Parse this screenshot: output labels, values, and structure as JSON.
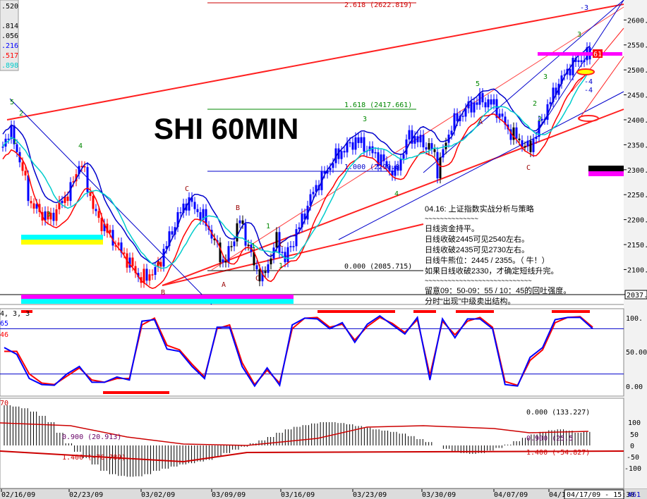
{
  "chart_data": {
    "type": "candlestick",
    "title": "SHI 60MIN",
    "price_axis": {
      "min": 2030,
      "max": 2640,
      "ticks": [
        "2600.",
        "2550.",
        "2500.",
        "2450.",
        "2400.",
        "2350.",
        "2300.",
        "2250.",
        "2200.",
        "2150.",
        "2100.",
        "2050."
      ],
      "current_price_label": "2037.4"
    },
    "left_values": [
      ".520",
      ".814",
      ".056",
      ".216",
      ".517",
      ".898"
    ],
    "left_value_colors": [
      "#000000",
      "#000000",
      "#000000",
      "#0000ff",
      "#ff0000",
      "#00cccc"
    ],
    "x_dates": [
      "02/16/09",
      "02/23/09",
      "03/02/09",
      "03/09/09",
      "03/16/09",
      "03/23/09",
      "03/30/09",
      "04/07/09",
      "04/1"
    ],
    "current_time_label": "04/17/09 - 15:30",
    "corner_label": "#61",
    "fib_labels": [
      "2.618 (2622.819)",
      "1.618 (2417.661)",
      "1.000 (2290.8",
      "0.000 (2085.715)"
    ],
    "wave_labels": {
      "digits": [
        "5",
        "2",
        "1",
        "4",
        "3",
        "2",
        "1",
        "3",
        "4",
        "5",
        "2",
        "1",
        "3",
        "3",
        "1"
      ],
      "letters": [
        "C",
        "B",
        "A",
        "B",
        "A",
        "C",
        "A",
        "C",
        "C"
      ]
    },
    "markers": [
      "-3",
      "-4",
      "-4",
      "61"
    ],
    "notes": {
      "title": "04.16: 上证指数实战分析与策略",
      "separator": "~~~~~~~~~~~~~~",
      "lines": [
        "日线资金持平。",
        "日线收破2445可见2540左右。",
        "日线收破2435可见2730左右。",
        "日线牛熊位：2445 / 2355。（ 牛！）",
        "如果日线收破2330，才确定短线升完。"
      ],
      "separator2": "~~~~~~~~~~~~~~~~~~~~~~~~~~~~",
      "lines2": [
        "留意09：50-09：55 / 10：45的回吐强度。",
        "分时“出现”中级卖出结构。"
      ]
    },
    "stochastic": {
      "header": "4, 3, 3",
      "left_values": [
        "65",
        "46"
      ],
      "ticks": [
        "100.",
        "50.00",
        "0.00"
      ],
      "k": [
        55,
        46,
        14,
        6,
        5,
        20,
        30,
        9,
        9,
        16,
        12,
        90,
        92,
        53,
        50,
        30,
        14,
        82,
        82,
        30,
        4,
        28,
        5,
        85,
        94,
        93,
        80,
        88,
        62,
        86,
        97,
        85,
        73,
        95,
        12,
        93,
        68,
        93,
        93,
        80,
        6,
        4,
        42,
        55,
        92,
        95,
        95,
        80
      ],
      "d": [
        50,
        50,
        20,
        8,
        6,
        17,
        28,
        12,
        9,
        14,
        14,
        85,
        94,
        58,
        52,
        33,
        16,
        80,
        85,
        35,
        6,
        25,
        8,
        80,
        94,
        95,
        82,
        86,
        65,
        83,
        95,
        87,
        75,
        92,
        18,
        90,
        72,
        90,
        95,
        82,
        10,
        5,
        38,
        52,
        88,
        95,
        96,
        82
      ]
    },
    "macd": {
      "header_left": "70",
      "labels": [
        "0.000 (133.227)",
        "0.900 (20.913)",
        "1.400 (-76.789)",
        "0.900 (25.5",
        "1.400 (-54.827)"
      ],
      "ticks": [
        "100",
        "50",
        "0",
        "-50",
        "-100"
      ],
      "histogram": [
        95,
        92,
        88,
        80,
        70,
        55,
        30,
        5,
        -15,
        -30,
        -45,
        -60,
        -68,
        -72,
        -74,
        -73,
        -68,
        -60,
        -55,
        -50,
        -45,
        -42,
        -38,
        -34,
        -26,
        -18,
        -10,
        -3,
        5,
        12,
        20,
        30,
        38,
        44,
        48,
        52,
        55,
        55,
        53,
        50,
        46,
        42,
        38,
        35,
        32,
        28,
        22,
        15,
        8,
        0,
        -8,
        -14,
        -18,
        -20,
        -18,
        -12,
        -6,
        2,
        10,
        18,
        26,
        32,
        36,
        38,
        35,
        30,
        32
      ]
    }
  }
}
